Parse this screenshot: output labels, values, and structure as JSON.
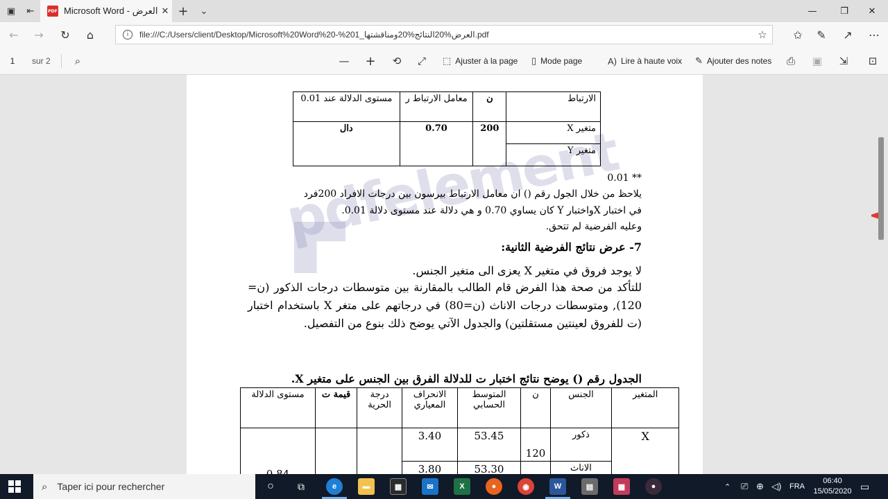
{
  "browser": {
    "tab_title": "Microsoft Word - العرض",
    "tab_icon_label": "PDF",
    "url": "file:///C:/Users/client/Desktop/Microsoft%20Word%20-%201_العرض%20النتائج%20ومناقشتها.pdf"
  },
  "pdf_toolbar": {
    "page_number": "1",
    "page_total": "sur 2",
    "fit_page": "Ajuster à la page",
    "page_mode": "Mode page",
    "read_aloud": "Lire à haute voix",
    "add_notes": "Ajouter des notes"
  },
  "document": {
    "table1": {
      "headers": [
        "الارتباط",
        "ن",
        "معامل الارتباط ر",
        "مستوى الدلالة عند 0.01"
      ],
      "var_x": "متغير X",
      "var_y": "متغير Y",
      "n": "200",
      "r": "0.70",
      "sig": "دال"
    },
    "footnote": "** 0.01",
    "para1": [
      "يلاحظ من خلال الجول رقم () ان معامل الارتباط بيرسون بين درجات الافراد    200فرد",
      "في اختبار  Xواختبار   Y كان يساوي 0.70 و هي دلالة عند مستوى دلالة 0.01.",
      "وعليه الفرضية لم تتحق."
    ],
    "heading": "7- عرض نتائج الفرضية الثانية:",
    "hypothesis": "لا يوجد فروق في متغير X يعزى الى متغير الجنس.",
    "body": "للتأكد من صحة هذا الفرض قام الطالب بالمقارنة بين متوسطات درجات الذكور (ن= 120), ومتوسطات درجات الاناث (ن=80) في درجاتهم على متغر X باستخدام اختبار (ت للفروق لعينتين مستقلتين) والجدول الآتي يوضح ذلك بنوع من التفصيل.",
    "table2_title": "الجدول رقم () يوضح نتائج اختبار ت للدلالة الفرق بين الجنس على متغير X.",
    "table2": {
      "headers": [
        "المتغير",
        "الجنس",
        "ن",
        "المتوسط الحسابي",
        "الانحراف المعياري",
        "درجة الحرية",
        "قيمة ت",
        "مستوى الدلالة"
      ],
      "var": "X",
      "male": "ذكور",
      "female": "الاناث",
      "n_male": "120",
      "mean_male": "53.45",
      "sd_male": "3.40",
      "mean_female": "53.30",
      "sd_female": "3.80",
      "sig": "0.84"
    },
    "watermark": "pdfelement"
  },
  "taskbar": {
    "search_placeholder": "Taper ici pour rechercher",
    "language": "FRA",
    "time": "06:40",
    "date": "15/05/2020"
  }
}
